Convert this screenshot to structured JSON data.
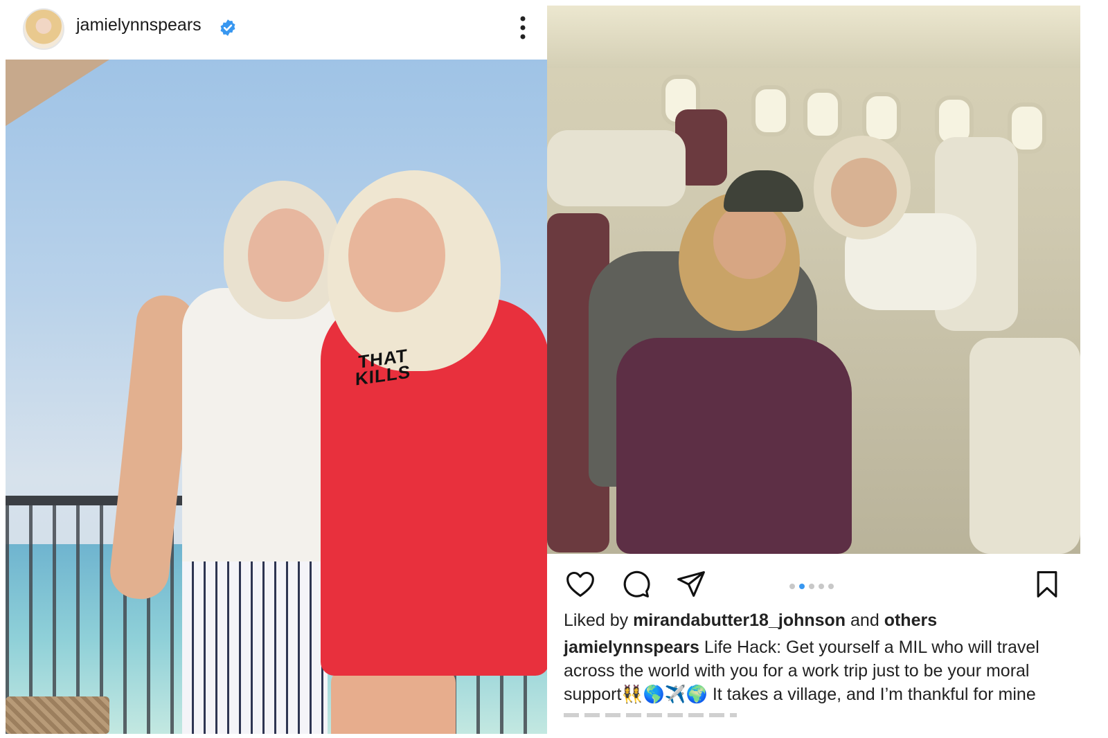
{
  "left_post": {
    "username": "jamielynnspears",
    "verified": true,
    "shirt_print": "THAT KILLS",
    "icons": {
      "verified": "verified-badge-icon",
      "more": "more-options-icon"
    },
    "colors": {
      "verified": "#3897f0",
      "shirt": "#e8303d"
    }
  },
  "right_post": {
    "carousel": {
      "count": 5,
      "active_index": 1
    },
    "icons": {
      "like": "heart-icon",
      "comment": "comment-bubble-icon",
      "share": "paper-plane-icon",
      "save": "bookmark-icon"
    },
    "liked": {
      "prefix": "Liked by",
      "user": "mirandabutter18_johnson",
      "connector": "and",
      "others": "others"
    },
    "caption": {
      "user": "jamielynnspears",
      "text": "Life Hack: Get yourself a MIL who will travel across the world with you for a work trip just to be your moral support👯‍♀️🌎✈️🌍 It takes a village, and I’m thankful for mine"
    }
  }
}
